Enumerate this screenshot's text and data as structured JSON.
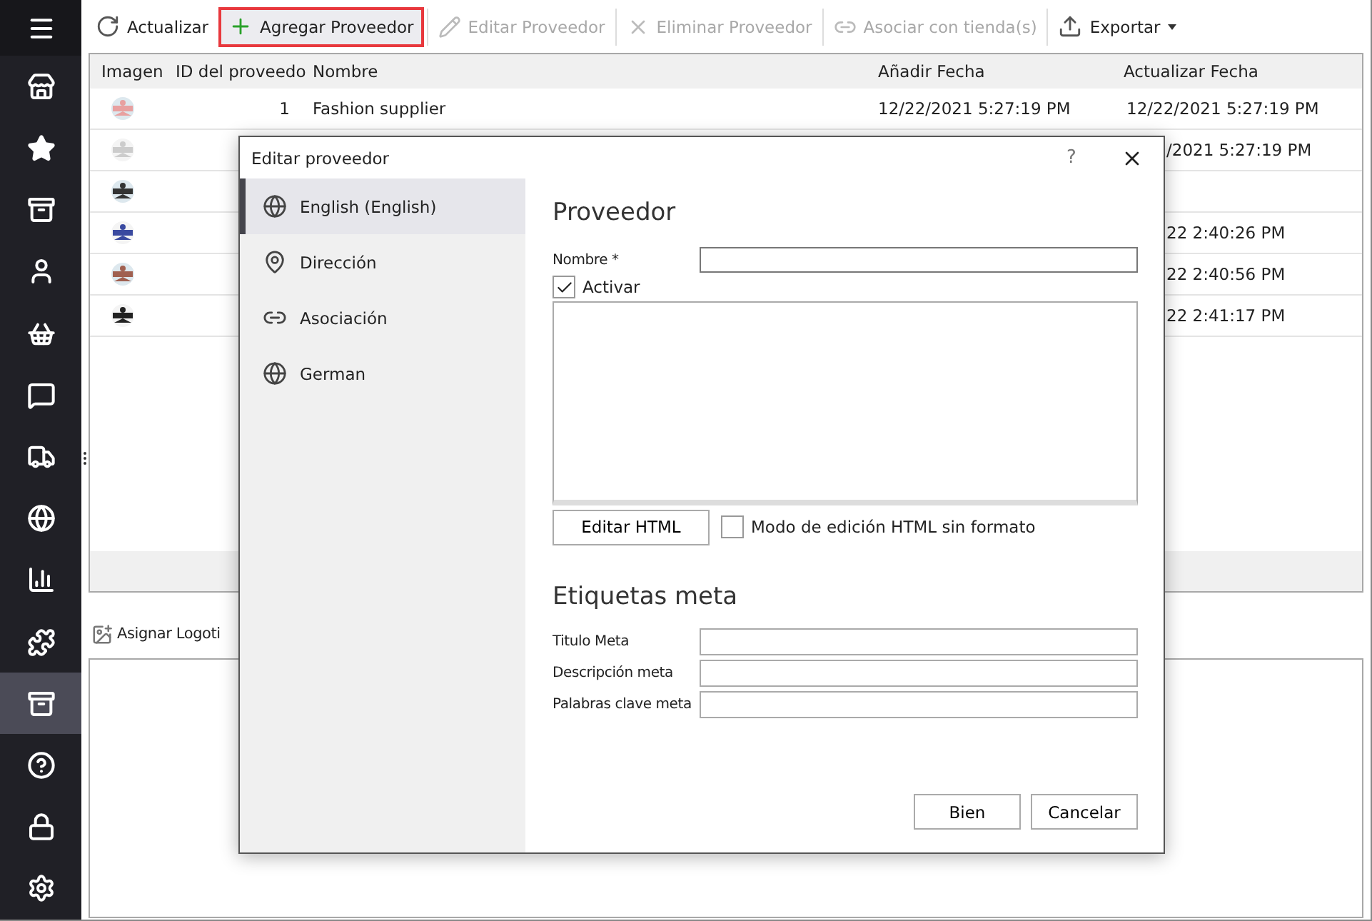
{
  "sidebar": {
    "items": [
      {
        "selected": false
      },
      {
        "selected": false
      },
      {
        "selected": false
      },
      {
        "selected": false
      },
      {
        "selected": false
      },
      {
        "selected": false
      },
      {
        "selected": false
      },
      {
        "selected": false
      },
      {
        "selected": false
      },
      {
        "selected": false
      },
      {
        "selected": false
      },
      {
        "selected": true
      },
      {
        "selected": false
      },
      {
        "selected": false
      },
      {
        "selected": false
      }
    ]
  },
  "toolbar": [
    {
      "kind": "refresh",
      "label": "Actualizar",
      "disabled": false,
      "highlighted": false
    },
    {
      "kind": "add",
      "label": "Agregar Proveedor",
      "disabled": false,
      "highlighted": true
    },
    {
      "kind": "edit",
      "label": "Editar Proveedor",
      "disabled": true,
      "highlighted": false
    },
    {
      "kind": "delete",
      "label": "Eliminar Proveedor",
      "disabled": true,
      "highlighted": false
    },
    {
      "kind": "link",
      "label": "Asociar con tienda(s)",
      "disabled": true,
      "highlighted": false
    },
    {
      "kind": "export",
      "label": "Exportar",
      "disabled": false,
      "highlighted": false
    }
  ],
  "table": {
    "columns": [
      "Imagen",
      "ID del proveedo",
      "Nombre",
      "Añadir Fecha",
      "Actualizar Fecha"
    ],
    "rows": [
      {
        "id": "1",
        "name": "Fashion supplier",
        "added": "12/22/2021 5:27:19 PM",
        "updated": "12/22/2021 5:27:19 PM",
        "updated_cut": false
      },
      {
        "updated": "/2021 5:27:19 PM",
        "updated_cut": true
      },
      {},
      {
        "updated": "22 2:40:26 PM",
        "updated_cut": true
      },
      {
        "updated": "22 2:40:56 PM",
        "updated_cut": true
      },
      {
        "updated": "22 2:41:17 PM",
        "updated_cut": true
      }
    ]
  },
  "logo_toolbar": {
    "label": "Asignar Logoti"
  },
  "dialog": {
    "title": "Editar proveedor",
    "help": "?",
    "nav": [
      {
        "kind": "globe",
        "label": "English (English)",
        "selected": true
      },
      {
        "kind": "pin",
        "label": "Dirección",
        "selected": false
      },
      {
        "kind": "link",
        "label": "Asociación",
        "selected": false
      },
      {
        "kind": "globe",
        "label": "German",
        "selected": false
      }
    ],
    "heading": "Proveedor",
    "name_label": "Nombre *",
    "active": {
      "label": "Activar",
      "checked": true
    },
    "edit_html": "Editar HTML",
    "raw_html": {
      "label": "Modo de edición HTML sin formato",
      "checked": false
    },
    "meta_heading": "Etiquetas meta",
    "meta_fields": [
      "Titulo Meta",
      "Descripción meta",
      "Palabras clave meta"
    ],
    "buttons": [
      "Bien",
      "Cancelar"
    ]
  }
}
